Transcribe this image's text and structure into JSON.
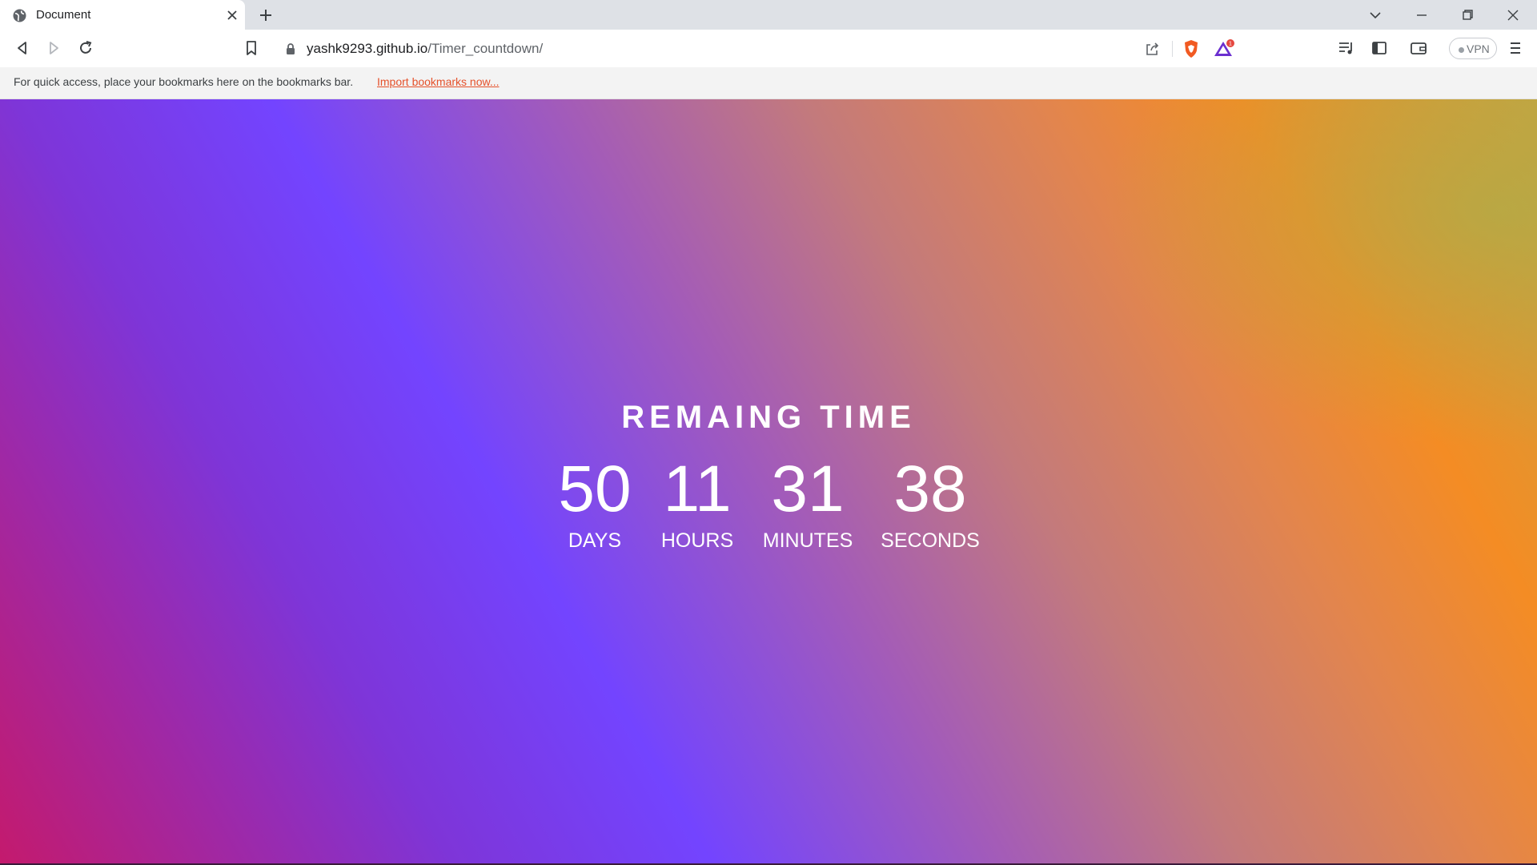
{
  "browser": {
    "tab": {
      "title": "Document",
      "favicon": "globe-icon"
    },
    "url": {
      "host": "yashk9293.github.io",
      "path": "/Timer_countdown/"
    },
    "extensions": {
      "vpn_label": "VPN",
      "rewards_badge": "1"
    },
    "bookmarks_bar": {
      "message": "For quick access, place your bookmarks here on the bookmarks bar.",
      "link": "Import bookmarks now..."
    }
  },
  "page": {
    "heading": "REMAING TIME",
    "units": [
      {
        "value": "50",
        "label": "DAYS"
      },
      {
        "value": "11",
        "label": "HOURS"
      },
      {
        "value": "31",
        "label": "MINUTES"
      },
      {
        "value": "38",
        "label": "SECONDS"
      }
    ]
  },
  "colors": {
    "accent_link": "#e5512b",
    "gradient": [
      "#c41a6d",
      "#7344ff",
      "#c37a7c",
      "#f48c24",
      "#c9a23f"
    ]
  }
}
